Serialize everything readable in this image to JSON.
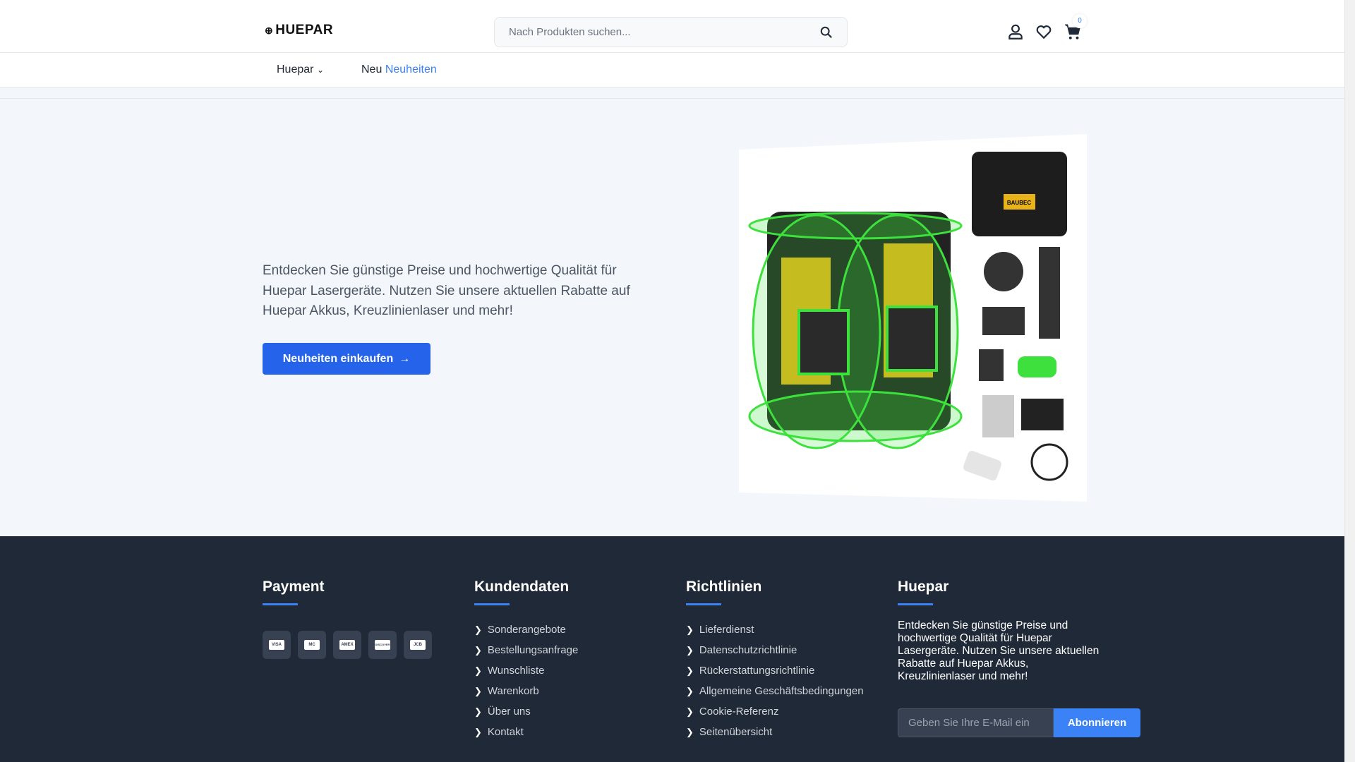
{
  "header": {
    "logo": "HUEPAR",
    "search_placeholder": "Nach Produkten suchen...",
    "cart_count": "0"
  },
  "nav": {
    "item1": "Huepar",
    "item2_prefix": "Neu",
    "item2_link": "Neuheiten"
  },
  "hero": {
    "text": "Entdecken Sie günstige Preise und hochwertige Qualität für Huepar Lasergeräte. Nutzen Sie unsere aktuellen Rabatte auf Huepar Akkus, Kreuzlinienlaser und mehr!",
    "button": "Neuheiten einkaufen",
    "case_brand": "BAUBEC"
  },
  "footer": {
    "payment": {
      "title": "Payment",
      "cards": [
        "VISA",
        "MC",
        "AMEX",
        "DISCOVER",
        "JCB"
      ]
    },
    "kundendaten": {
      "title": "Kundendaten",
      "links": [
        "Sonderangebote",
        "Bestellungsanfrage",
        "Wunschliste",
        "Warenkorb",
        "Über uns",
        "Kontakt"
      ]
    },
    "richtlinien": {
      "title": "Richtlinien",
      "links": [
        "Lieferdienst",
        "Datenschutzrichtlinie",
        "Rückerstattungsrichtlinie",
        "Allgemeine Geschäftsbedingungen",
        "Cookie-Referenz",
        "Seitenübersicht"
      ]
    },
    "huepar": {
      "title": "Huepar",
      "text": "Entdecken Sie günstige Preise und hochwertige Qualität für Huepar Lasergeräte. Nutzen Sie unsere aktuellen Rabatte auf Huepar Akkus, Kreuzlinienlaser und mehr!",
      "email_placeholder": "Geben Sie Ihre E-Mail ein",
      "subscribe": "Abonnieren"
    }
  },
  "colors": {
    "accent": "#2563eb",
    "footer_bg": "#1f2937",
    "hero_bg": "#f3f6fa"
  }
}
